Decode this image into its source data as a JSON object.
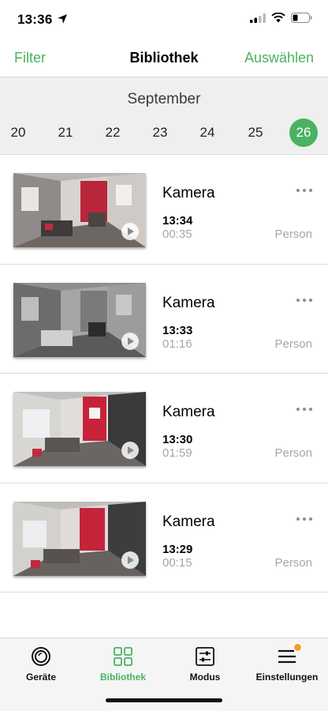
{
  "status_bar": {
    "time": "13:36"
  },
  "nav": {
    "left": "Filter",
    "title": "Bibliothek",
    "right": "Auswählen"
  },
  "calendar": {
    "month": "September",
    "days": [
      "20",
      "21",
      "22",
      "23",
      "24",
      "25",
      "26"
    ],
    "selected_day": "26"
  },
  "recordings": [
    {
      "title": "Kamera",
      "time": "13:34",
      "duration": "00:35",
      "tag": "Person"
    },
    {
      "title": "Kamera",
      "time": "13:33",
      "duration": "01:16",
      "tag": "Person"
    },
    {
      "title": "Kamera",
      "time": "13:30",
      "duration": "01:59",
      "tag": "Person"
    },
    {
      "title": "Kamera",
      "time": "13:29",
      "duration": "00:15",
      "tag": "Person"
    }
  ],
  "tabs": [
    {
      "label": "Geräte",
      "icon": "camera-lens-icon"
    },
    {
      "label": "Bibliothek",
      "icon": "grid-icon",
      "active": true
    },
    {
      "label": "Modus",
      "icon": "sliders-icon"
    },
    {
      "label": "Einstellungen",
      "icon": "menu-icon",
      "badge": true
    }
  ],
  "colors": {
    "accent": "#4ab262",
    "badge": "#f0a023"
  }
}
